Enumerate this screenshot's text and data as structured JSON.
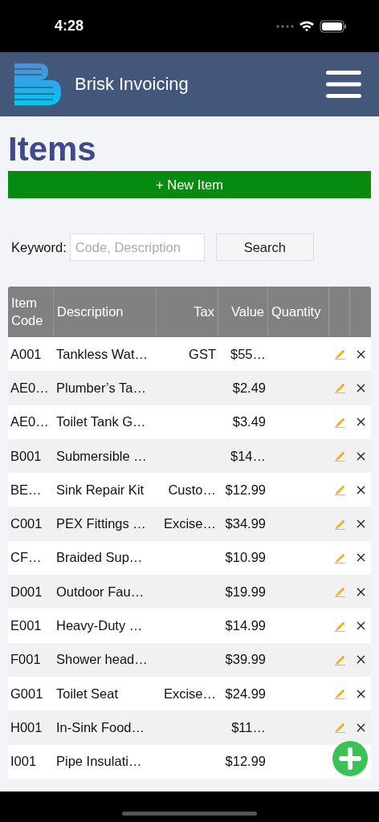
{
  "status_bar": {
    "time": "4:28"
  },
  "header": {
    "title": "Brisk Invoicing"
  },
  "page": {
    "title": "Items",
    "new_button": "+ New Item"
  },
  "search": {
    "label": "Keyword:",
    "placeholder": "Code, Description",
    "button": "Search"
  },
  "table": {
    "columns": [
      {
        "label": "Item Code"
      },
      {
        "label": "Description"
      },
      {
        "label": "Tax"
      },
      {
        "label": "Value"
      },
      {
        "label": "Quantity"
      }
    ],
    "rows": [
      {
        "code": "A001",
        "description": "Tankless Wat…",
        "tax": "GST",
        "value": "$55…"
      },
      {
        "code": "AE0…",
        "description": "Plumber’s Ta…",
        "value": "$2.49"
      },
      {
        "code": "AE0…",
        "description": "Toilet Tank G…",
        "value": "$3.49"
      },
      {
        "code": "B001",
        "description": "Submersible …",
        "value": "$14…"
      },
      {
        "code": "BE…",
        "description": "Sink Repair Kit",
        "tax": "Custo…",
        "value": "$12.99"
      },
      {
        "code": "C001",
        "description": "PEX Fittings …",
        "tax": "Excise…",
        "value": "$34.99"
      },
      {
        "code": "CF…",
        "description": "Braided Sup…",
        "value": "$10.99"
      },
      {
        "code": "D001",
        "description": "Outdoor Fau…",
        "value": "$19.99"
      },
      {
        "code": "E001",
        "description": "Heavy-Duty …",
        "value": "$14.99"
      },
      {
        "code": "F001",
        "description": "Shower head…",
        "value": "$39.99"
      },
      {
        "code": "G001",
        "description": "Toilet Seat",
        "tax": "Excise…",
        "value": "$24.99"
      },
      {
        "code": "H001",
        "description": "In-Sink Food…",
        "value": "$11…"
      },
      {
        "code": "I001",
        "description": "Pipe Insulati…",
        "value": "$12.99"
      }
    ]
  }
}
